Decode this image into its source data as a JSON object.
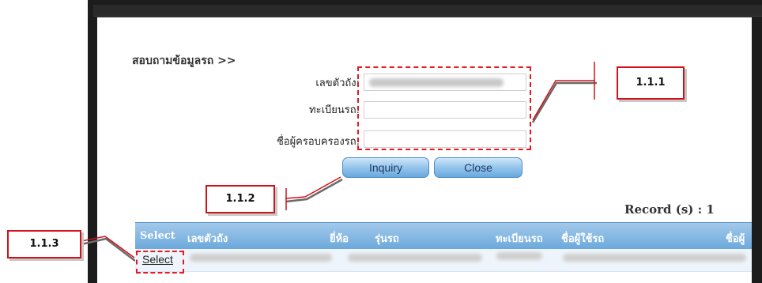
{
  "form": {
    "title": "สอบถามข้อมูลรถ >>",
    "fields": [
      {
        "label": "เลขตัวถัง:"
      },
      {
        "label": "ทะเบียนรถ:"
      },
      {
        "label": "ชื่อผู้ครอบครองรถ:"
      }
    ]
  },
  "buttons": {
    "inquiry": "Inquiry",
    "close": "Close"
  },
  "callouts": {
    "fields_group": "1.1.1",
    "buttons_group": "1.1.2",
    "select_link": "1.1.3"
  },
  "results": {
    "record_count": "Record (s) : 1",
    "columns": [
      "Select",
      "เลขตัวถัง",
      "ยี่ห้อ",
      "รุ่นรถ",
      "ทะเบียนรถ",
      "ชื่อผู้ใช้รถ",
      "ชื่อผู้"
    ],
    "row_action": "Select"
  },
  "colors": {
    "highlight": "#e8181f",
    "header_blue": "#6aa8dc",
    "button_blue": "#8fc1ea"
  }
}
